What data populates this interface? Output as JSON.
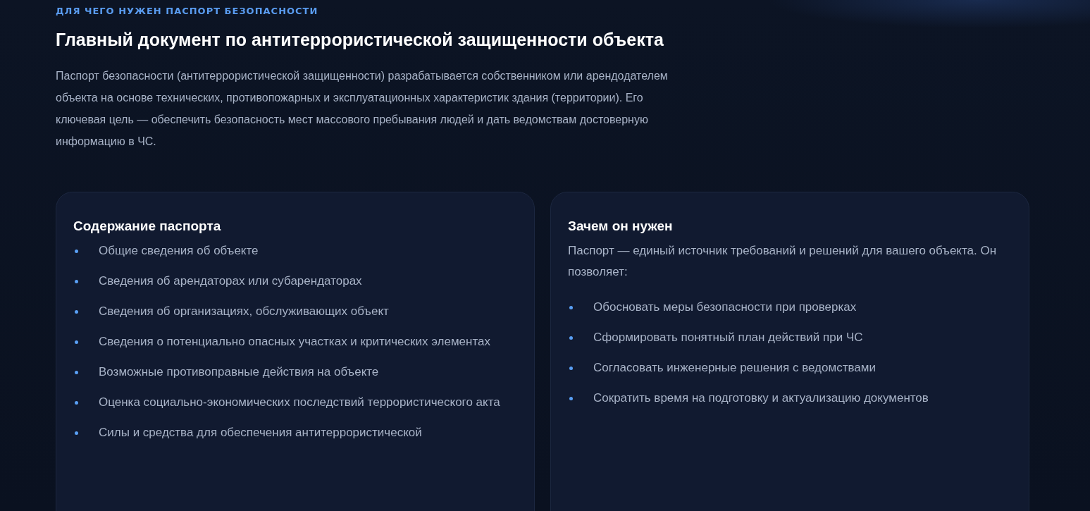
{
  "section": {
    "eyebrow": "ДЛЯ ЧЕГО НУЖЕН ПАСПОРТ БЕЗОПАСНОСТИ",
    "title": "Главный документ по антитеррористической защищенности объекта",
    "intro": "Паспорт безопасности (антитеррористической защищенности) разрабатывается собственником или арендодателем объекта на основе технических, противопожарных и эксплуатационных характеристик здания (территории). Его ключевая цель — обеспечить безопасность мест массового пребывания людей и дать ведомствам достоверную информацию в ЧС."
  },
  "cards": [
    {
      "title": "Содержание паспорта",
      "items": [
        "Общие сведения об объекте",
        "Сведения об арендаторах или субарендаторах",
        "Сведения об организациях, обслуживающих объект",
        "Сведения о потенциально опасных участках и критических элементах",
        "Возможные противоправные действия на объекте",
        "Оценка социально-экономических последствий террористического акта",
        "Силы и средства для обеспечения антитеррористической"
      ]
    },
    {
      "title": "Зачем он нужен",
      "lead": "Паспорт — единый источник требований и решений для вашего объекта. Он позволяет:",
      "items": [
        "Обосновать меры безопасности при проверках",
        "Сформировать понятный план действий при ЧС",
        "Согласовать инженерные решения с ведомствами",
        "Сократить время на подготовку и актуализацию документов"
      ]
    }
  ]
}
